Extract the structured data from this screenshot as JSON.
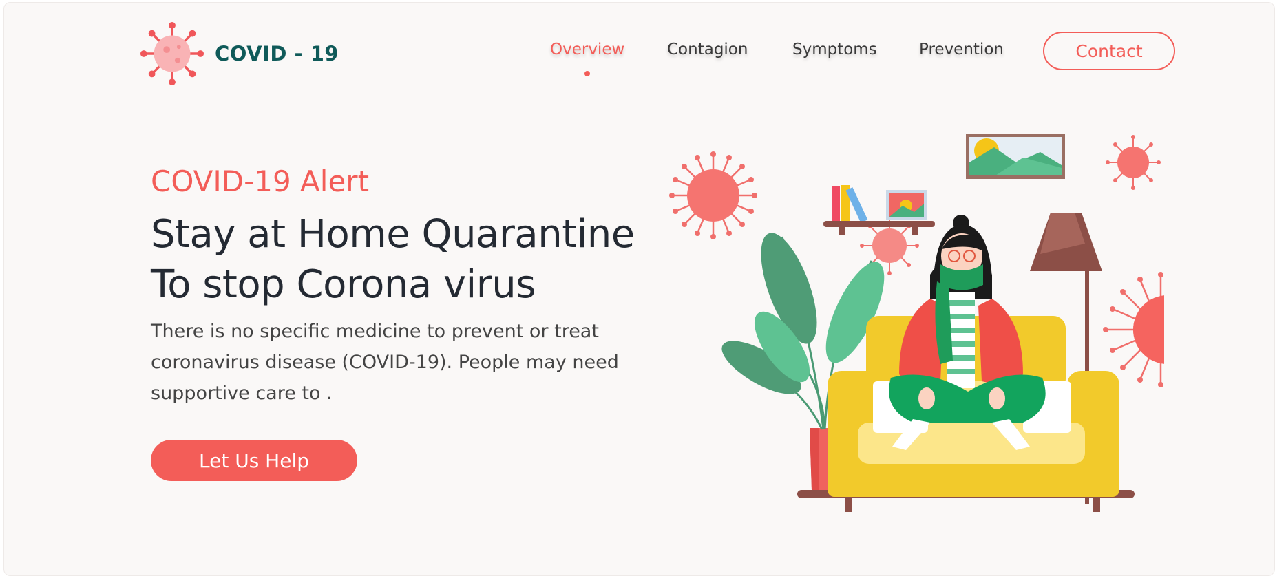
{
  "brand": {
    "name": "COVID - 19",
    "logo_icon": "virus-icon"
  },
  "nav": {
    "items": [
      {
        "label": "Overview",
        "active": true
      },
      {
        "label": "Contagion",
        "active": false
      },
      {
        "label": "Symptoms",
        "active": false
      },
      {
        "label": "Prevention",
        "active": false
      }
    ],
    "contact_label": "Contact"
  },
  "hero": {
    "eyebrow": "COVID-19 Alert",
    "headline_line1": "Stay at Home Quarantine",
    "headline_line2": "To stop Corona virus",
    "description": "There is no specific medicine to prevent or treat coronavirus disease (COVID-19). People may need supportive care to .",
    "cta_label": "Let Us Help"
  },
  "colors": {
    "accent": "#f35d58",
    "brand_text": "#0f5a59",
    "heading": "#242a33",
    "background": "#faf8f7"
  }
}
